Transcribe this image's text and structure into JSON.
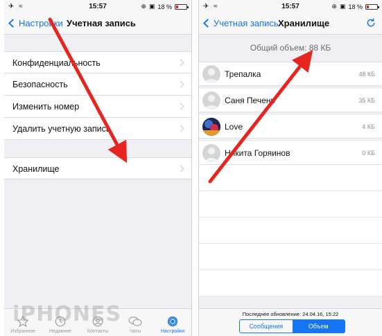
{
  "status_bar_left": {
    "time": "15:57",
    "battery": "18 %",
    "battery_fraction": 0.18,
    "left_icons": "✈ ≈"
  },
  "status_bar_right": {
    "time": "15:57",
    "battery": "18 %",
    "battery_fraction": 0.18,
    "left_icons": "✈ ≈"
  },
  "left_screen": {
    "back_label": "Настройки",
    "title": "Учетная запись",
    "items": [
      {
        "label": "Конфиденциальность"
      },
      {
        "label": "Безопасность"
      },
      {
        "label": "Изменить номер"
      },
      {
        "label": "Удалить учетную запись"
      }
    ],
    "storage_label": "Хранилище",
    "tabs": [
      {
        "label": "Избранное",
        "icon": "star-icon"
      },
      {
        "label": "Недавние",
        "icon": "clock-icon"
      },
      {
        "label": "Контакты",
        "icon": "contacts-icon"
      },
      {
        "label": "Чаты",
        "icon": "chats-icon"
      },
      {
        "label": "Настройки",
        "icon": "gear-icon"
      }
    ],
    "watermark": "iPHONES"
  },
  "right_screen": {
    "back_label": "Учетная запись",
    "title": "Хранилище",
    "total": "Общий объем: 88 КБ",
    "chats": [
      {
        "name": "Трепалка",
        "size": "48 КБ",
        "avatar": "generic"
      },
      {
        "name": "Саня Печень",
        "size": "35 КБ",
        "avatar": "generic"
      },
      {
        "name": "Love",
        "size": "4 КБ",
        "avatar": "photo"
      },
      {
        "name": "Никита Горяинов",
        "size": "0 КБ",
        "avatar": "generic"
      }
    ],
    "last_update": "Последнее обновление: 24.04.16, 15:22",
    "segment": {
      "messages": "Сообщения",
      "volume": "Объем",
      "selected": "Объем"
    }
  },
  "colors": {
    "accent": "#1476f2",
    "annotation_arrow": "#e8241f"
  }
}
